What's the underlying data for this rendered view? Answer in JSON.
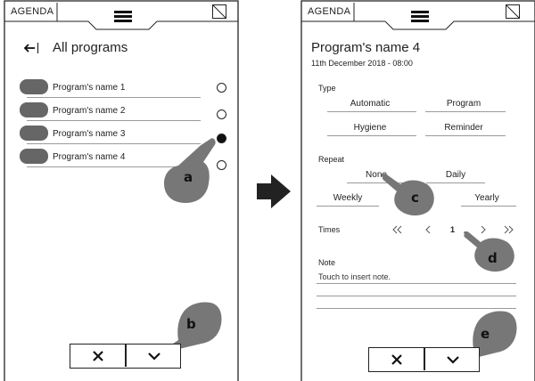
{
  "screen1": {
    "header": {
      "title": "AGENDA",
      "menu_icon": "hamburger-icon",
      "corner_icon": "fold-corner-icon"
    },
    "nav": {
      "back_icon": "back-arrow-icon",
      "title": "All programs"
    },
    "programs": [
      {
        "name": "Program's name 1",
        "selected": false
      },
      {
        "name": "Program's name 2",
        "selected": false
      },
      {
        "name": "Program's name 3",
        "selected": true
      },
      {
        "name": "Program's name 4",
        "selected": false
      }
    ],
    "footer": {
      "cancel_icon": "close-icon",
      "confirm_icon": "chevron-down-icon"
    },
    "annotations": {
      "a": "a",
      "b": "b"
    }
  },
  "transition_icon": "right-arrow-icon",
  "screen2": {
    "header": {
      "title": "AGENDA",
      "menu_icon": "hamburger-icon",
      "corner_icon": "fold-corner-icon"
    },
    "program": {
      "title": "Program's name 4",
      "date": "11th December 2018 - 08:00"
    },
    "type": {
      "label": "Type",
      "options": [
        "Automatic",
        "Program",
        "Hygiene",
        "Reminder"
      ]
    },
    "repeat": {
      "label": "Repeat",
      "options": [
        "None",
        "Daily",
        "Weekly",
        "Yearly"
      ]
    },
    "times": {
      "label": "Times",
      "first_icon": "double-chevron-left-icon",
      "prev_icon": "chevron-left-icon",
      "value": "1",
      "next_icon": "chevron-right-icon",
      "last_icon": "double-chevron-right-icon"
    },
    "note": {
      "label": "Note",
      "placeholder": "Touch to insert note."
    },
    "footer": {
      "cancel_icon": "close-icon",
      "confirm_icon": "chevron-down-icon"
    },
    "annotations": {
      "c": "c",
      "d": "d",
      "e": "e"
    }
  }
}
